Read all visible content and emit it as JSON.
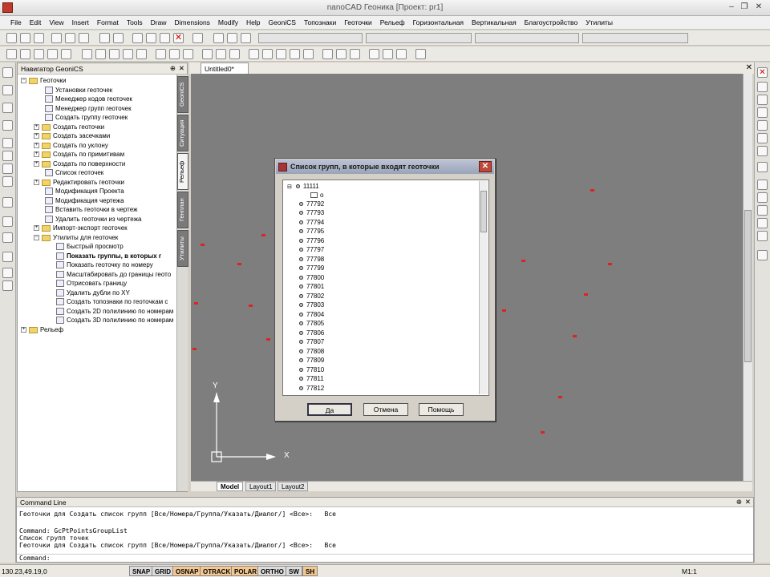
{
  "window": {
    "title": "nanoCAD Геоника [Проект: pr1]",
    "minimize": "–",
    "restore": "❐",
    "close": "✕"
  },
  "menu": [
    "File",
    "Edit",
    "View",
    "Insert",
    "Format",
    "Tools",
    "Draw",
    "Dimensions",
    "Modify",
    "Help",
    "GeoniCS",
    "Топознаки",
    "Геоточки",
    "Рельеф",
    "Горизонтальная",
    "Вертикальная",
    "Благоустройство",
    "Утилиты"
  ],
  "navigator": {
    "title": "Навигатор GeoniCS",
    "pin": "⊕",
    "close": "✕",
    "tree": [
      {
        "label": "Геоточки",
        "exp": "−"
      },
      {
        "label": "Установки геоточек"
      },
      {
        "label": "Менеджер кодов геоточек"
      },
      {
        "label": "Менеджер групп геоточек"
      },
      {
        "label": "Создать группу геоточек"
      },
      {
        "label": "Создать геоточки",
        "exp": "+"
      },
      {
        "label": "Создать засечками",
        "exp": "+"
      },
      {
        "label": "Создать по уклону",
        "exp": "+"
      },
      {
        "label": "Создать по примитивам",
        "exp": "+"
      },
      {
        "label": "Создать по поверхности",
        "exp": "+"
      },
      {
        "label": "Список геоточек"
      },
      {
        "label": "Редактировать геоточки",
        "exp": "+"
      },
      {
        "label": "Модификация Проекта"
      },
      {
        "label": "Модификация чертежа"
      },
      {
        "label": "Вставить геоточки в чертеж"
      },
      {
        "label": "Удалить геоточки из чертежа"
      },
      {
        "label": "Импорт-экспорт геоточек",
        "exp": "+"
      },
      {
        "label": "Утилиты для геоточек",
        "exp": "−"
      },
      {
        "label": "Быстрый просмотр"
      },
      {
        "label": "Показать группы, в которых г"
      },
      {
        "label": "Показать геоточку по номеру"
      },
      {
        "label": "Масштабировать до границы геото"
      },
      {
        "label": "Отрисовать границу"
      },
      {
        "label": "Удалить дубли по XY"
      },
      {
        "label": "Создать топознаки по геоточкам с"
      },
      {
        "label": "Создать 2D полилинию по номерам"
      },
      {
        "label": "Создать 3D полилинию по номерам"
      },
      {
        "label": "Рельеф",
        "exp": "+"
      }
    ],
    "tabs": [
      "GeoniCS",
      "Ситуация",
      "Рельеф",
      "Генплан",
      "Утилиты"
    ]
  },
  "document": {
    "tab": "Untitled0*",
    "close": "✕"
  },
  "layouts": [
    "Model",
    "Layout1",
    "Layout2"
  ],
  "ucs": {
    "y": "Y",
    "x": "X"
  },
  "dialog": {
    "title": "Список групп, в которые входят геоточки",
    "close": "✕",
    "root": "11111",
    "root_child": "o",
    "items": [
      "77792",
      "77793",
      "77794",
      "77795",
      "77796",
      "77797",
      "77798",
      "77799",
      "77800",
      "77801",
      "77802",
      "77803",
      "77804",
      "77805",
      "77806",
      "77807",
      "77808",
      "77809",
      "77810",
      "77811",
      "77812"
    ],
    "ok": "Да",
    "cancel": "Отмена",
    "help": "Помощь"
  },
  "cmdline": {
    "title": "Command Line",
    "pin": "⊕",
    "close": "✕",
    "lines": [
      "Геоточки для Создать список групп [Все/Номера/Группа/Указать/Диалог/] <Все>:   Все",
      "",
      "Command: GcPtPointsGroupList",
      "Список групп точек",
      "Геоточки для Создать список групп [Все/Номера/Группа/Указать/Диалог/] <Все>:   Все"
    ],
    "prompt": "Command:"
  },
  "status": {
    "coords": "130.23,49.19,0",
    "buttons": [
      {
        "label": "SNAP",
        "on": false
      },
      {
        "label": "GRID",
        "on": false
      },
      {
        "label": "OSNAP",
        "on": true
      },
      {
        "label": "OTRACK",
        "on": true
      },
      {
        "label": "POLAR",
        "on": true
      },
      {
        "label": "ORTHO",
        "on": false
      },
      {
        "label": "SW",
        "on": false
      },
      {
        "label": "SH",
        "on": true
      }
    ],
    "scale": "M1:1"
  }
}
